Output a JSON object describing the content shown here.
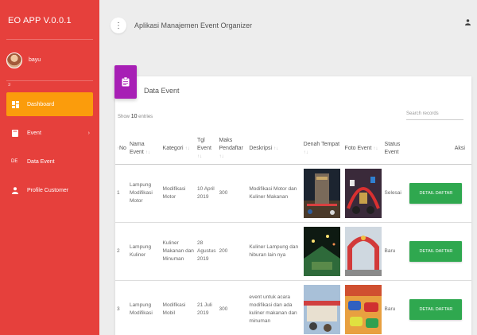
{
  "app": {
    "brand": "EO  APP V.0.0.1",
    "title": "Aplikasi Manajemen Event Organizer",
    "user_name": "bayu",
    "sep_mark": "3",
    "colors": {
      "sidebar": "#e6403c",
      "active": "#fb9c0c",
      "badge": "#a71fb5",
      "button": "#2fa84f"
    }
  },
  "sidebar": {
    "items": [
      {
        "label": "Dashboard",
        "icon": "dashboard-icon",
        "active": true
      },
      {
        "label": "Event",
        "icon": "book-icon",
        "has_children": true
      },
      {
        "label": "Data Event",
        "abbr": "DE"
      },
      {
        "label": "Profile Customer",
        "icon": "person-icon"
      }
    ]
  },
  "card": {
    "title": "Data Event",
    "show_prefix": "Show",
    "show_value": "10",
    "show_suffix": "entries",
    "search_placeholder": "Search records"
  },
  "table": {
    "headers": {
      "no": "No",
      "nama": "Nama Event",
      "kategori": "Kategori",
      "tgl": "Tgl Event",
      "maks": "Maks Pendaftar",
      "deskripsi": "Deskripsi",
      "denah": "Denah Tempat",
      "foto": "Foto Event",
      "status": "Status Event",
      "aksi": "Aksi"
    },
    "rows": [
      {
        "no": "1",
        "nama": "Lampung Modifikasi Motor",
        "kategori": "Modifikasi Motor",
        "tgl": "10 April 2019",
        "maks": "300",
        "deskripsi": "Modifikasi Motor dan Kuliner Makanan",
        "status": "Selesai",
        "action": "DETAIL DAFTAR"
      },
      {
        "no": "2",
        "nama": "Lampung Kuliner",
        "kategori": "Kuliner Makanan dan Minuman",
        "tgl": "28 Agustus 2019",
        "maks": "200",
        "deskripsi": "Kuliner Lampung dan hiburan lain nya",
        "status": "Baru",
        "action": "DETAIL DAFTAR"
      },
      {
        "no": "3",
        "nama": "Lampung Modifikasi",
        "kategori": "Modifikasi Mobil",
        "tgl": "21 Juli 2019",
        "maks": "300",
        "deskripsi": "event untuk acara modifikasi dan ada kuliner makanan dan minuman",
        "status": "Baru",
        "action": "DETAIL DAFTAR"
      }
    ]
  }
}
